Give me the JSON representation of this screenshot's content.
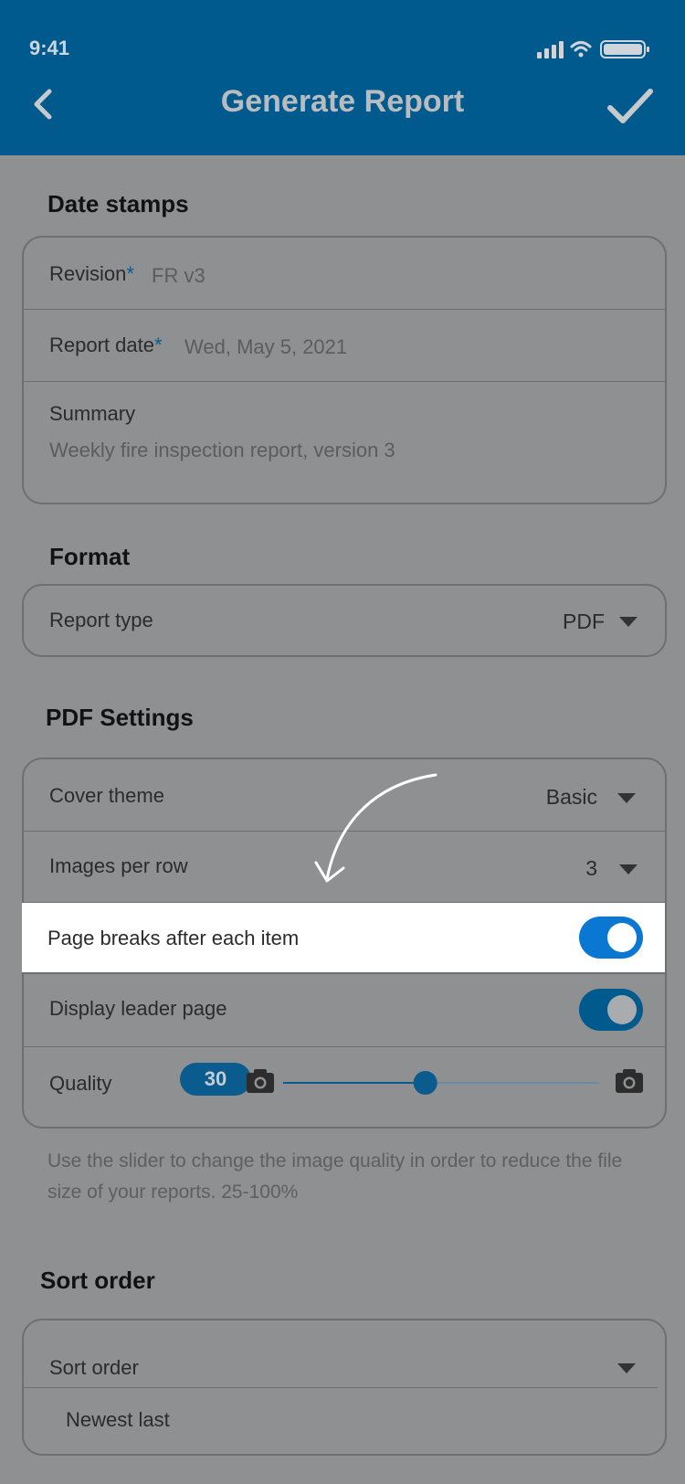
{
  "status_bar": {
    "time": "9:41"
  },
  "header": {
    "title": "Generate Report",
    "back_icon": "chevron-left-icon",
    "confirm_icon": "checkmark-icon"
  },
  "date_stamps": {
    "title": "Date stamps",
    "revision_label": "Revision",
    "revision_value": "FR v3",
    "report_date_label": "Report date",
    "report_date_value": "Wed, May 5, 2021",
    "required_mark": "*",
    "summary_label": "Summary",
    "summary_value": "Weekly fire inspection report, version 3"
  },
  "format": {
    "title": "Format",
    "report_type_label": "Report type",
    "report_type_value": "PDF"
  },
  "pdf_settings": {
    "title": "PDF Settings",
    "cover_theme_label": "Cover theme",
    "cover_theme_value": "Basic",
    "images_per_row_label": "Images per row",
    "images_per_row_value": "3",
    "page_breaks_label": "Page breaks after each item",
    "page_breaks_on": true,
    "leader_page_label": "Display leader page",
    "leader_page_on": true,
    "quality_label": "Quality",
    "quality_value": "30",
    "quality_slider_fraction": 0.45,
    "slider_min_icon": "camera-icon",
    "slider_max_icon": "camera-icon"
  },
  "help_text": "Use the slider to change the image quality in order to reduce the file size of your reports. 25-100%",
  "sort": {
    "title": "Sort order",
    "label": "Sort order",
    "value": "Newest last"
  },
  "colors": {
    "brand_blue": "#005a8e",
    "toggle_on": "#0a78d2",
    "accent": "#0a5c8f"
  }
}
